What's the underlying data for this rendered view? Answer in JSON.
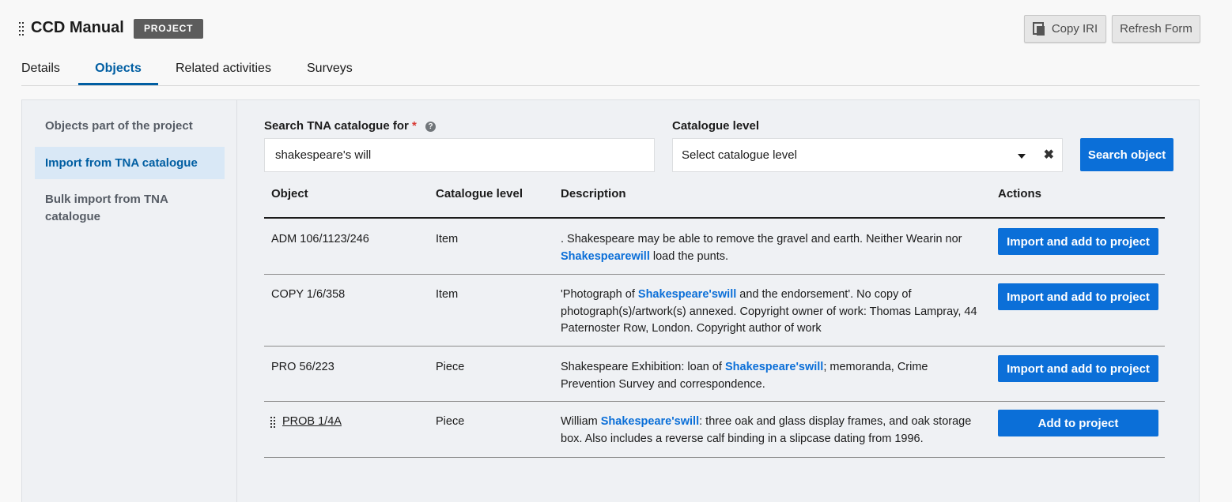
{
  "header": {
    "title": "CCD Manual",
    "badge": "PROJECT",
    "copy_iri_label": "Copy IRI",
    "refresh_label": "Refresh Form"
  },
  "tabs": [
    {
      "label": "Details",
      "active": false
    },
    {
      "label": "Objects",
      "active": true
    },
    {
      "label": "Related activities",
      "active": false
    },
    {
      "label": "Surveys",
      "active": false
    }
  ],
  "sidenav": {
    "items": [
      {
        "label": "Objects part of the project",
        "active": false
      },
      {
        "label": "Import from TNA catalogue",
        "active": true
      },
      {
        "label": "Bulk import from TNA catalogue",
        "active": false
      }
    ]
  },
  "search": {
    "label": "Search TNA catalogue for",
    "required_mark": "*",
    "help_icon": "?",
    "value": "shakespeare's will",
    "level_label": "Catalogue level",
    "level_placeholder": "Select catalogue level",
    "clear_icon": "✖",
    "button_label": "Search object"
  },
  "table": {
    "headers": [
      "Object",
      "Catalogue level",
      "Description",
      "Actions"
    ],
    "rows": [
      {
        "object": "ADM 106/1123/246",
        "level": "Item",
        "desc_pre": ". Shakespeare may be able to remove the gravel and earth. Neither Wearin nor ",
        "desc_hl": "Shakespearewill",
        "desc_post": " load the punts.",
        "action": "Import and add to project"
      },
      {
        "object": "COPY 1/6/358",
        "level": "Item",
        "desc_pre": "'Photograph of ",
        "desc_hl": "Shakespeare'swill",
        "desc_post": " and the endorsement'. No copy of photograph(s)/artwork(s) annexed. Copyright owner of work: Thomas Lampray, 44 Paternoster Row, London. Copyright author of work",
        "action": "Import and add to project"
      },
      {
        "object": "PRO 56/223",
        "level": "Piece",
        "desc_pre": "Shakespeare Exhibition: loan of ",
        "desc_hl": "Shakespeare'swill",
        "desc_post": "; memoranda, Crime Prevention Survey and correspondence.",
        "action": "Import and add to project"
      },
      {
        "object": "PROB 1/4A",
        "level": "Piece",
        "desc_pre": "William ",
        "desc_hl": "Shakespeare'swill",
        "desc_post": ": three oak and glass display frames, and oak storage box. Also includes a reverse calf binding in a slipcase dating from 1996.",
        "action": "Add to project"
      }
    ]
  }
}
